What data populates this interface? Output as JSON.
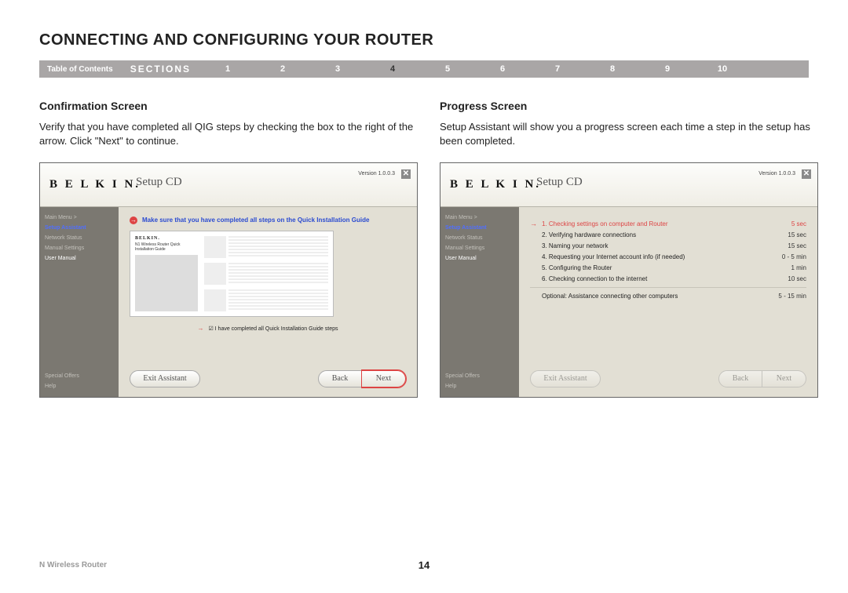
{
  "title": "CONNECTING AND CONFIGURING YOUR ROUTER",
  "nav": {
    "toc": "Table of Contents",
    "sections_label": "SECTIONS",
    "numbers": [
      "1",
      "2",
      "3",
      "4",
      "5",
      "6",
      "7",
      "8",
      "9",
      "10"
    ],
    "active_index": 3
  },
  "left": {
    "heading": "Confirmation Screen",
    "desc": "Verify that you have completed all QIG steps by checking the box to the right of the arrow. Click \"Next\" to continue."
  },
  "right": {
    "heading": "Progress Screen",
    "desc": "Setup Assistant will show you a progress screen each time a step in the setup has been completed."
  },
  "app": {
    "brand": "B E L K I N.",
    "title": "Setup CD",
    "version": "Version 1.0.0.3",
    "sidebar": {
      "main_menu": "Main Menu  >",
      "setup_assistant": "Setup Assistant",
      "network_status": "Network Status",
      "manual_settings": "Manual Settings",
      "user_manual": "User Manual",
      "special_offers": "Special Offers",
      "help": "Help"
    },
    "instruction": "Make sure that you have completed all steps on the Quick Installation Guide",
    "guide": {
      "brand": "BELKIN.",
      "sub": "N1 Wireless Router   Quick Installation Guide"
    },
    "checkbox_label": "I have completed all Quick Installation Guide steps",
    "buttons": {
      "exit": "Exit Assistant",
      "back": "Back",
      "next": "Next"
    },
    "steps": [
      {
        "label": "1. Checking settings on computer and Router",
        "time": "5 sec"
      },
      {
        "label": "2. Verifying hardware connections",
        "time": "15 sec"
      },
      {
        "label": "3. Naming your network",
        "time": "15 sec"
      },
      {
        "label": "4. Requesting your Internet account info (if needed)",
        "time": "0 - 5 min"
      },
      {
        "label": "5. Configuring the Router",
        "time": "1 min"
      },
      {
        "label": "6. Checking connection to the internet",
        "time": "10 sec"
      }
    ],
    "optional": {
      "label": "Optional: Assistance connecting other computers",
      "time": "5 - 15 min"
    }
  },
  "footer": {
    "product": "N Wireless Router",
    "page": "14"
  }
}
